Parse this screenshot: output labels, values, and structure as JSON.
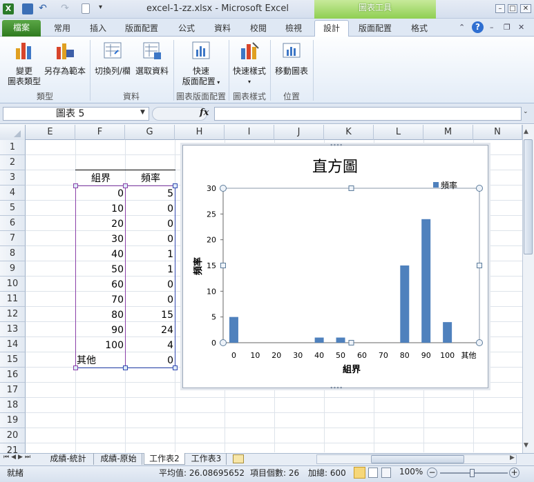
{
  "window": {
    "title": "excel-1-zz.xlsx - Microsoft Excel",
    "contextual_tab": "圖表工具"
  },
  "tabs": {
    "file": "檔案",
    "home": "常用",
    "insert": "插入",
    "page_layout": "版面配置",
    "formulas": "公式",
    "data": "資料",
    "review": "校閱",
    "view": "檢視",
    "design": "設計",
    "layout": "版面配置",
    "format": "格式"
  },
  "ribbon": {
    "change_type_1": "變更",
    "change_type_2": "圖表類型",
    "save_template": "另存為範本",
    "group_type": "類型",
    "switch_row_col": "切換列/欄",
    "select_data": "選取資料",
    "group_data": "資料",
    "quick_layout_1": "快速",
    "quick_layout_2": "版面配置",
    "group_layouts": "圖表版面配置",
    "quick_styles": "快速樣式",
    "group_styles": "圖表樣式",
    "move_chart": "移動圖表",
    "group_location": "位置"
  },
  "formula_bar": {
    "name_box": "圖表 5",
    "fx": "fx",
    "formula": ""
  },
  "columns": [
    "E",
    "F",
    "G",
    "H",
    "I",
    "J",
    "K",
    "L",
    "M",
    "N"
  ],
  "rows": [
    "1",
    "2",
    "3",
    "4",
    "5",
    "6",
    "7",
    "8",
    "9",
    "10",
    "11",
    "12",
    "13",
    "14",
    "15",
    "16",
    "17",
    "18",
    "19",
    "20",
    "21"
  ],
  "table": {
    "header_f": "組界",
    "header_g": "頻率",
    "bins": [
      "0",
      "10",
      "20",
      "30",
      "40",
      "50",
      "60",
      "70",
      "80",
      "90",
      "100",
      "其他"
    ],
    "freq": [
      "5",
      "0",
      "0",
      "0",
      "1",
      "1",
      "0",
      "0",
      "15",
      "24",
      "4",
      "0"
    ]
  },
  "sheets": [
    "成績-統計",
    "成績-原始",
    "工作表2",
    "工作表3"
  ],
  "status": {
    "ready": "就緒",
    "average": "平均值: 26.08695652",
    "count": "項目個數: 26",
    "sum": "加總: 600",
    "zoom": "100%"
  },
  "chart_data": {
    "type": "bar",
    "title": "直方圖",
    "xlabel": "組界",
    "ylabel": "頻率",
    "categories": [
      "0",
      "10",
      "20",
      "30",
      "40",
      "50",
      "60",
      "70",
      "80",
      "90",
      "100",
      "其他"
    ],
    "series": [
      {
        "name": "頻率",
        "values": [
          5,
          0,
          0,
          0,
          1,
          1,
          0,
          0,
          15,
          24,
          4,
          0
        ],
        "color": "#4f81bd"
      }
    ],
    "ylim": [
      0,
      30
    ],
    "yticks": [
      "0",
      "5",
      "10",
      "15",
      "20",
      "25",
      "30"
    ],
    "legend": "top-right",
    "grid": false
  }
}
